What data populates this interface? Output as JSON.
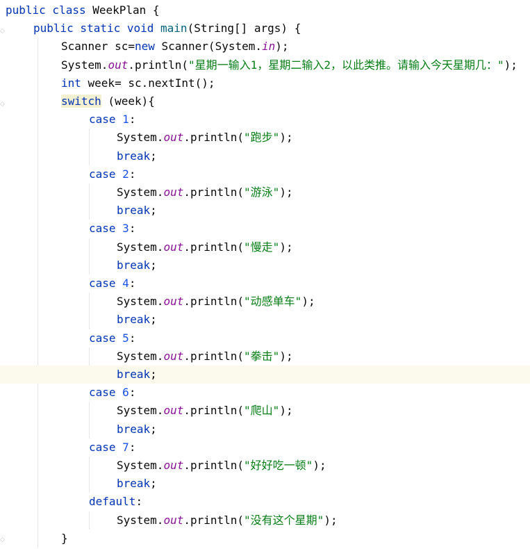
{
  "editor": {
    "current_line": 20,
    "lines": [
      {
        "indent": 0,
        "tokens": [
          {
            "t": "public class ",
            "c": "kw"
          },
          {
            "t": "WeekPlan {",
            "c": "pl"
          }
        ]
      },
      {
        "indent": 1,
        "tokens": [
          {
            "t": "public static void ",
            "c": "kw"
          },
          {
            "t": "main",
            "c": "fn"
          },
          {
            "t": "(String[] args) {",
            "c": "pl"
          }
        ]
      },
      {
        "indent": 2,
        "tokens": [
          {
            "t": "Scanner sc=",
            "c": "pl"
          },
          {
            "t": "new ",
            "c": "kw"
          },
          {
            "t": "Scanner(System.",
            "c": "pl"
          },
          {
            "t": "in",
            "c": "fld"
          },
          {
            "t": ");",
            "c": "pl"
          }
        ]
      },
      {
        "indent": 2,
        "tokens": [
          {
            "t": "System.",
            "c": "pl"
          },
          {
            "t": "out",
            "c": "fld"
          },
          {
            "t": ".println(",
            "c": "pl"
          },
          {
            "t": "\"星期一输入1，星期二输入2，以此类推。请输入今天星期几：\"",
            "c": "str"
          },
          {
            "t": ");",
            "c": "pl"
          }
        ]
      },
      {
        "indent": 2,
        "tokens": [
          {
            "t": "int ",
            "c": "kw"
          },
          {
            "t": "week= sc.nextInt();",
            "c": "pl"
          }
        ]
      },
      {
        "indent": 2,
        "tokens": [
          {
            "t": "switch",
            "c": "kw switch-hl"
          },
          {
            "t": " (week){",
            "c": "pl"
          }
        ]
      },
      {
        "indent": 3,
        "tokens": [
          {
            "t": "case ",
            "c": "kw"
          },
          {
            "t": "1",
            "c": "num"
          },
          {
            "t": ":",
            "c": "pl"
          }
        ]
      },
      {
        "indent": 4,
        "tokens": [
          {
            "t": "System.",
            "c": "pl"
          },
          {
            "t": "out",
            "c": "fld"
          },
          {
            "t": ".println(",
            "c": "pl"
          },
          {
            "t": "\"跑步\"",
            "c": "str"
          },
          {
            "t": ");",
            "c": "pl"
          }
        ]
      },
      {
        "indent": 4,
        "tokens": [
          {
            "t": "break",
            "c": "kw"
          },
          {
            "t": ";",
            "c": "pl"
          }
        ]
      },
      {
        "indent": 3,
        "tokens": [
          {
            "t": "case ",
            "c": "kw"
          },
          {
            "t": "2",
            "c": "num"
          },
          {
            "t": ":",
            "c": "pl"
          }
        ]
      },
      {
        "indent": 4,
        "tokens": [
          {
            "t": "System.",
            "c": "pl"
          },
          {
            "t": "out",
            "c": "fld"
          },
          {
            "t": ".println(",
            "c": "pl"
          },
          {
            "t": "\"游泳\"",
            "c": "str"
          },
          {
            "t": ");",
            "c": "pl"
          }
        ]
      },
      {
        "indent": 4,
        "tokens": [
          {
            "t": "break",
            "c": "kw"
          },
          {
            "t": ";",
            "c": "pl"
          }
        ]
      },
      {
        "indent": 3,
        "tokens": [
          {
            "t": "case ",
            "c": "kw"
          },
          {
            "t": "3",
            "c": "num"
          },
          {
            "t": ":",
            "c": "pl"
          }
        ]
      },
      {
        "indent": 4,
        "tokens": [
          {
            "t": "System.",
            "c": "pl"
          },
          {
            "t": "out",
            "c": "fld"
          },
          {
            "t": ".println(",
            "c": "pl"
          },
          {
            "t": "\"慢走\"",
            "c": "str"
          },
          {
            "t": ");",
            "c": "pl"
          }
        ]
      },
      {
        "indent": 4,
        "tokens": [
          {
            "t": "break",
            "c": "kw"
          },
          {
            "t": ";",
            "c": "pl"
          }
        ]
      },
      {
        "indent": 3,
        "tokens": [
          {
            "t": "case ",
            "c": "kw"
          },
          {
            "t": "4",
            "c": "num"
          },
          {
            "t": ":",
            "c": "pl"
          }
        ]
      },
      {
        "indent": 4,
        "tokens": [
          {
            "t": "System.",
            "c": "pl"
          },
          {
            "t": "out",
            "c": "fld"
          },
          {
            "t": ".println(",
            "c": "pl"
          },
          {
            "t": "\"动感单车\"",
            "c": "str"
          },
          {
            "t": ");",
            "c": "pl"
          }
        ]
      },
      {
        "indent": 4,
        "tokens": [
          {
            "t": "break",
            "c": "kw"
          },
          {
            "t": ";",
            "c": "pl"
          }
        ]
      },
      {
        "indent": 3,
        "tokens": [
          {
            "t": "case ",
            "c": "kw"
          },
          {
            "t": "5",
            "c": "num"
          },
          {
            "t": ":",
            "c": "pl"
          }
        ]
      },
      {
        "indent": 4,
        "tokens": [
          {
            "t": "System.",
            "c": "pl"
          },
          {
            "t": "out",
            "c": "fld"
          },
          {
            "t": ".println(",
            "c": "pl"
          },
          {
            "t": "\"拳击\"",
            "c": "str"
          },
          {
            "t": ");",
            "c": "pl"
          }
        ]
      },
      {
        "indent": 4,
        "tokens": [
          {
            "t": "break",
            "c": "kw"
          },
          {
            "t": ";",
            "c": "pl"
          }
        ]
      },
      {
        "indent": 3,
        "tokens": [
          {
            "t": "case ",
            "c": "kw"
          },
          {
            "t": "6",
            "c": "num"
          },
          {
            "t": ":",
            "c": "pl"
          }
        ]
      },
      {
        "indent": 4,
        "tokens": [
          {
            "t": "System.",
            "c": "pl"
          },
          {
            "t": "out",
            "c": "fld"
          },
          {
            "t": ".println(",
            "c": "pl"
          },
          {
            "t": "\"爬山\"",
            "c": "str"
          },
          {
            "t": ");",
            "c": "pl"
          }
        ]
      },
      {
        "indent": 4,
        "tokens": [
          {
            "t": "break",
            "c": "kw"
          },
          {
            "t": ";",
            "c": "pl"
          }
        ]
      },
      {
        "indent": 3,
        "tokens": [
          {
            "t": "case ",
            "c": "kw"
          },
          {
            "t": "7",
            "c": "num"
          },
          {
            "t": ":",
            "c": "pl"
          }
        ]
      },
      {
        "indent": 4,
        "tokens": [
          {
            "t": "System.",
            "c": "pl"
          },
          {
            "t": "out",
            "c": "fld"
          },
          {
            "t": ".println(",
            "c": "pl"
          },
          {
            "t": "\"好好吃一顿\"",
            "c": "str"
          },
          {
            "t": ");",
            "c": "pl"
          }
        ]
      },
      {
        "indent": 4,
        "tokens": [
          {
            "t": "break",
            "c": "kw"
          },
          {
            "t": ";",
            "c": "pl"
          }
        ]
      },
      {
        "indent": 3,
        "tokens": [
          {
            "t": "default",
            "c": "kw"
          },
          {
            "t": ":",
            "c": "pl"
          }
        ]
      },
      {
        "indent": 4,
        "tokens": [
          {
            "t": "System.",
            "c": "pl"
          },
          {
            "t": "out",
            "c": "fld"
          },
          {
            "t": ".println(",
            "c": "pl"
          },
          {
            "t": "\"没有这个星期\"",
            "c": "str"
          },
          {
            "t": ");",
            "c": "pl"
          }
        ]
      },
      {
        "indent": 2,
        "tokens": [
          {
            "t": "}",
            "c": "pl"
          }
        ]
      }
    ]
  },
  "colors": {
    "keyword": "#0033b3",
    "method": "#00627a",
    "static_field": "#871094",
    "string": "#067d17",
    "number": "#1750eb",
    "plain": "#080808",
    "current_line_bg": "#fcfaed"
  },
  "gutter_icons": [
    "fold-marker-icon",
    "fold-marker-icon",
    "fold-end-icon"
  ]
}
